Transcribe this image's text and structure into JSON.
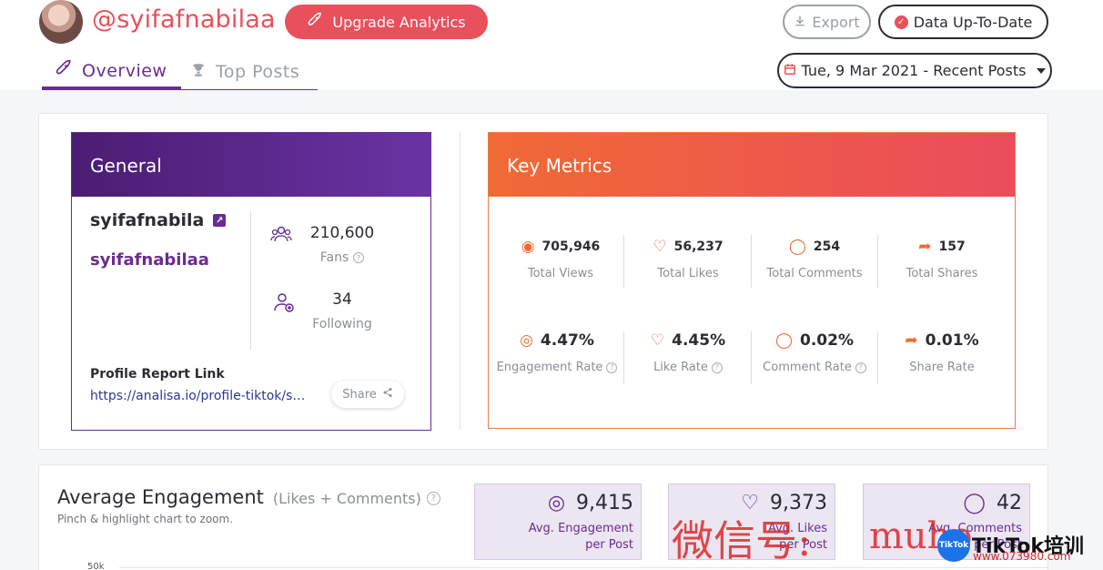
{
  "profile": {
    "handle": "@syifafnabilaa"
  },
  "buttons": {
    "upgrade": "Upgrade Analytics",
    "export": "Export",
    "uptodate": "Data Up-To-Date",
    "date_range": "Tue, 9 Mar 2021 - Recent Posts"
  },
  "tabs": {
    "overview": "Overview",
    "top_posts": "Top Posts"
  },
  "general": {
    "title": "General",
    "name": "syifafnabila",
    "username": "syifafnabilaa",
    "fans_value": "210,600",
    "fans_label": "Fans",
    "following_value": "34",
    "following_label": "Following",
    "report_title": "Profile Report Link",
    "report_link": "https://analisa.io/profile-tiktok/syifafnabilaa",
    "share": "Share"
  },
  "key_metrics": {
    "title": "Key Metrics",
    "totals": [
      {
        "value": "705,946",
        "label": "Total Views",
        "icon": "eye-icon"
      },
      {
        "value": "56,237",
        "label": "Total Likes",
        "icon": "heart-icon"
      },
      {
        "value": "254",
        "label": "Total Comments",
        "icon": "comment-icon"
      },
      {
        "value": "157",
        "label": "Total Shares",
        "icon": "share-arrow-icon"
      }
    ],
    "rates": [
      {
        "value": "4.47%",
        "label": "Engagement Rate",
        "icon": "engagement-icon"
      },
      {
        "value": "4.45%",
        "label": "Like Rate",
        "icon": "heart-icon"
      },
      {
        "value": "0.02%",
        "label": "Comment Rate",
        "icon": "comment-icon"
      },
      {
        "value": "0.01%",
        "label": "Share Rate",
        "icon": "share-arrow-icon"
      }
    ]
  },
  "average_engagement": {
    "title": "Average Engagement",
    "subtitle": "(Likes + Comments)",
    "hint": "Pinch & highlight chart to zoom.",
    "axis_label": "50k",
    "boxes": [
      {
        "value": "9,415",
        "label_line1": "Avg. Engagement",
        "label_line2": "per Post"
      },
      {
        "value": "9,373",
        "label_line1": "Avg. Likes",
        "label_line2": "per Post"
      },
      {
        "value": "42",
        "label_line1": "Avg. Comments",
        "label_line2": "per Post"
      }
    ]
  },
  "watermark": {
    "text1": "微信号:",
    "text2": "muho",
    "logo_text": "TikTok",
    "brand": "TikTok培训",
    "url": "www.073980.com"
  },
  "colors": {
    "accent": "#e8505b",
    "purple": "#6a2c91",
    "orange": "#f06a35"
  }
}
